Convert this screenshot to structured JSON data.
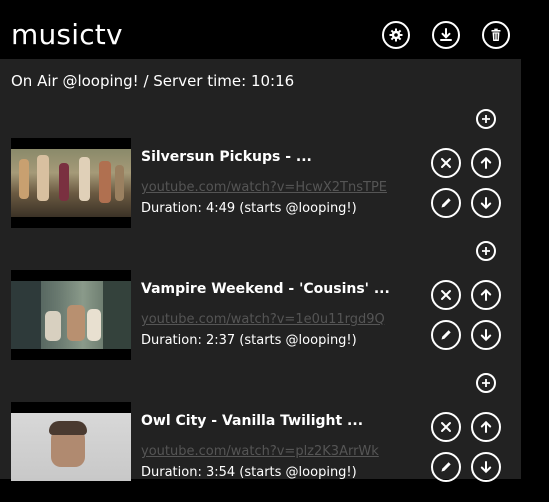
{
  "app": {
    "title": "musictv"
  },
  "header": {
    "buttons": [
      {
        "name": "settings-button",
        "icon": "gear-icon"
      },
      {
        "name": "download-button",
        "icon": "download-icon"
      },
      {
        "name": "delete-button",
        "icon": "trash-icon"
      }
    ]
  },
  "status": {
    "text": "On Air @looping! / Server time: 10:16"
  },
  "playlist": [
    {
      "title": "Silversun Pickups - ...",
      "link": "youtube.com/watch?v=HcwX2TnsTPE",
      "duration": "Duration: 4:49 (starts @looping!)"
    },
    {
      "title": "Vampire Weekend - 'Cousins' ...",
      "link": "youtube.com/watch?v=1e0u11rgd9Q",
      "duration": "Duration: 2:37 (starts @looping!)"
    },
    {
      "title": "Owl City - Vanilla Twilight ...",
      "link": "youtube.com/watch?v=plz2K3ArrWk",
      "duration": "Duration: 3:54 (starts @looping!)"
    }
  ],
  "colors": {
    "panel": "#222222",
    "background": "#000000",
    "link": "#555555"
  }
}
